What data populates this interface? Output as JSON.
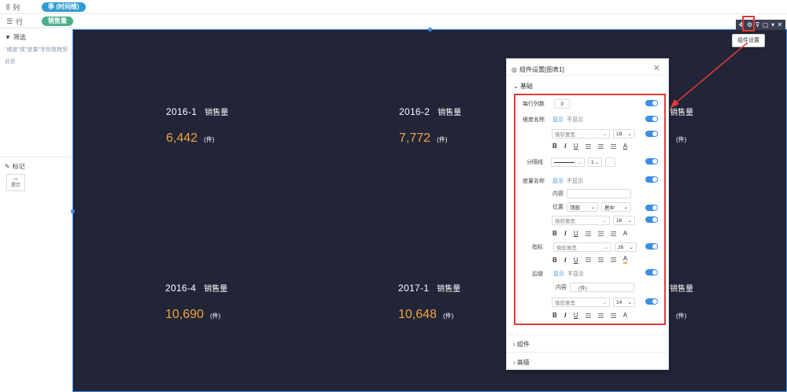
{
  "shelf": {
    "columns_label": "列",
    "columns_pill": "季 (时间维)",
    "rows_label": "行",
    "rows_pill": "销售量"
  },
  "left_panel": {
    "filter_title": "筛选",
    "filter_hint": "\"维度\"或\"度量\"字段拖拽到此处",
    "marks_title": "标记",
    "marks_tile": "提示"
  },
  "kpis": [
    {
      "dim": "2016-1",
      "measure": "销售量",
      "value": "6,442",
      "unit": "(件)"
    },
    {
      "dim": "2016-2",
      "measure": "销售量",
      "value": "7,772",
      "unit": "(件)"
    },
    {
      "dim": "",
      "measure": "销售量",
      "value": "",
      "unit": "(件)"
    },
    {
      "dim": "2016-4",
      "measure": "销售量",
      "value": "10,690",
      "unit": "(件)"
    },
    {
      "dim": "2017-1",
      "measure": "销售量",
      "value": "10,648",
      "unit": "(件)"
    },
    {
      "dim": "",
      "measure": "销售量",
      "value": "",
      "unit": "(件)"
    }
  ],
  "toolbar": {
    "tooltip": "组件设置"
  },
  "panel": {
    "title": "组件设置[图表1]",
    "sec_basic": "基础",
    "per_row_label": "每行列数",
    "per_row_value": "3",
    "dim_name_label": "维度名称",
    "show": "显示",
    "hide": "不显示",
    "font": "微软雅黑",
    "dim_size": "18",
    "sep_label": "分隔线",
    "sep_width": "1",
    "meas_name_label": "度量名称",
    "content_label": "内容",
    "position_label": "位置",
    "pos_top": "顶部",
    "pos_center": "居中",
    "meas_size": "16",
    "indicator_label": "指标",
    "ind_size": "26",
    "suffix_label": "后缀",
    "suffix_content": "(件)",
    "suffix_size": "14",
    "sec_component": "组件",
    "sec_advanced": "高级"
  },
  "colors": {
    "canvas": "#222438",
    "value": "#f0a43a",
    "accent": "#3a8ee6",
    "highlight": "#e53935"
  }
}
